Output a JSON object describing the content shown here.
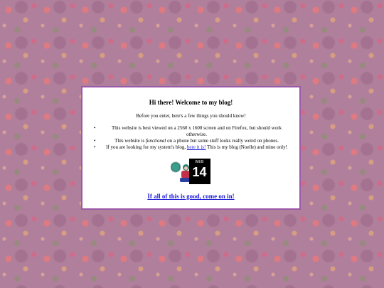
{
  "title": "Hi there! Welcome to my blog!",
  "intro": "Before you enter, here's a few things you should know!",
  "notes": [
    {
      "text": "This website is best viewed on a 2560 x 1600 screen and on Firefox, but should work otherwise."
    },
    {
      "prefix": "This website is ",
      "emphasis": "functional",
      "suffix": " on a phone but some stuff looks really weird on phones."
    },
    {
      "prefix": "If you are looking for my system's blog, ",
      "link_label": "here it is!",
      "suffix": " This is my blog (Noelle) and mine only!"
    }
  ],
  "badge": {
    "label_top": "WEB",
    "label_number": "14"
  },
  "enter_link": "If all of this is good, come on in!",
  "colors": {
    "background": "#b07f9c",
    "box_border": "#9b5aa8",
    "link": "#1b1bd6"
  }
}
